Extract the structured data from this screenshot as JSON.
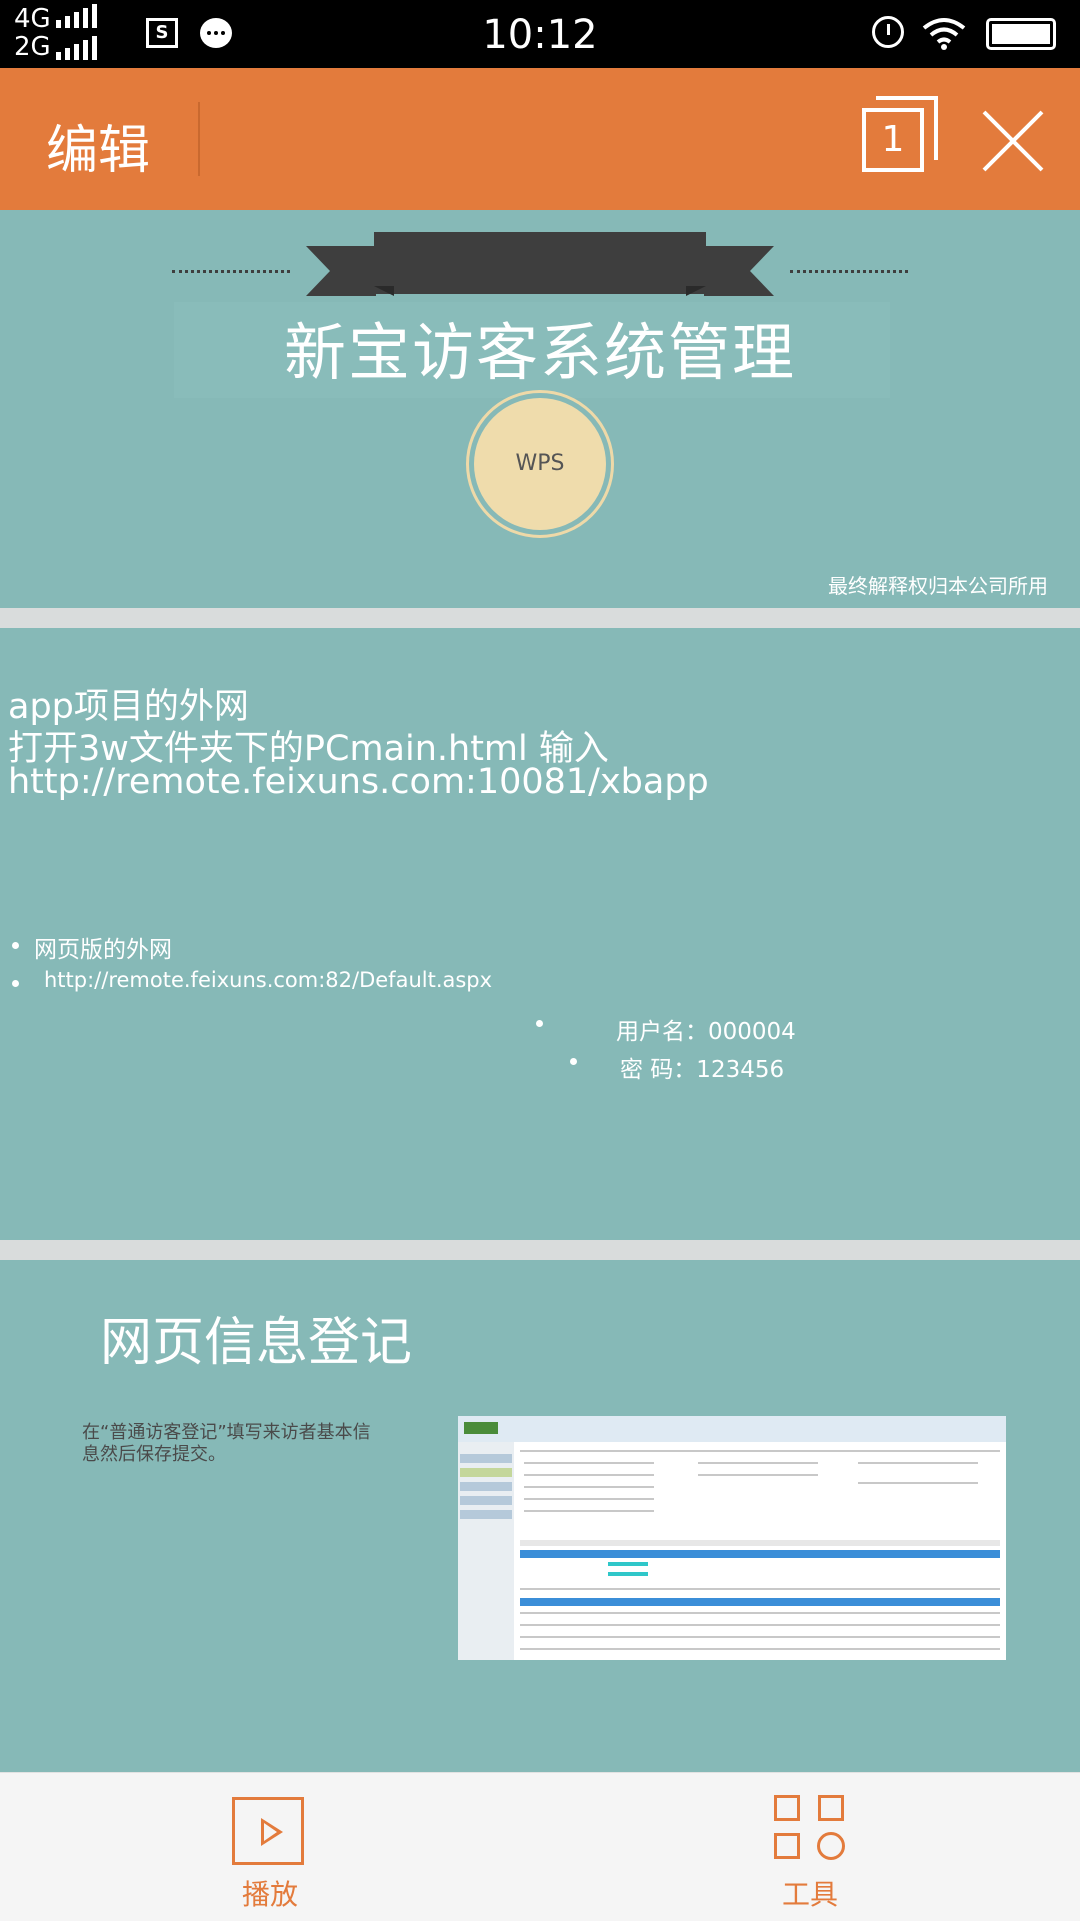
{
  "status_bar": {
    "network_top": "4G",
    "network_bottom": "2G",
    "time": "10:12",
    "icons": [
      "signal-icon",
      "sim-app-icon",
      "message-bubble-icon",
      "alarm-icon",
      "wifi-icon",
      "battery-icon"
    ]
  },
  "app_bar": {
    "title": "编辑",
    "page_count": "1",
    "accent_color": "#e37b3c"
  },
  "slide1": {
    "title": "新宝访客系统管理",
    "badge": "WPS",
    "footnote": "最终解释权归本公司所用"
  },
  "slide2": {
    "line1": "app项目的外网",
    "line2": "打开3w文件夹下的PCmain.html      输入",
    "line3": "http://remote.feixuns.com:10081/xbapp",
    "bullet1": "网页版的外网",
    "bullet2": "http://remote.feixuns.com:82/Default.aspx",
    "bullet3": "用户名：000004",
    "bullet4": "密    码：123456"
  },
  "slide3": {
    "title": "网页信息登记",
    "description": "在“普通访客登记”填写来访者基本信息然后保存提交。"
  },
  "bottom_bar": {
    "play_label": "播放",
    "tools_label": "工具"
  },
  "colors": {
    "slide_background": "#86b9b7",
    "ribbon": "#3e3e3e",
    "badge_fill": "#efdcac"
  }
}
